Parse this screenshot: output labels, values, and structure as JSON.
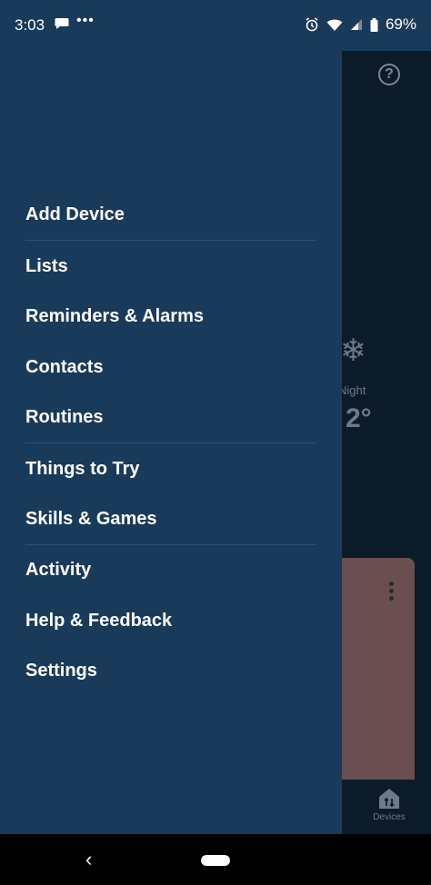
{
  "status_bar": {
    "time": "3:03",
    "more_dots": "•••",
    "battery": "69%"
  },
  "drawer": {
    "items": [
      {
        "label": "Add Device"
      },
      {
        "label": "Lists"
      },
      {
        "label": "Reminders & Alarms"
      },
      {
        "label": "Contacts"
      },
      {
        "label": "Routines"
      },
      {
        "label": "Things to Try"
      },
      {
        "label": "Skills & Games"
      },
      {
        "label": "Activity"
      },
      {
        "label": "Help & Feedback"
      },
      {
        "label": "Settings"
      }
    ]
  },
  "background": {
    "help": "?",
    "weather_label": "Night",
    "temperature": "2°",
    "devices_label": "Devices"
  },
  "nav": {
    "back": "‹"
  },
  "colors": {
    "drawer": "#1a3a5a",
    "divider": "#2e5070",
    "card": "#6b4f50"
  }
}
